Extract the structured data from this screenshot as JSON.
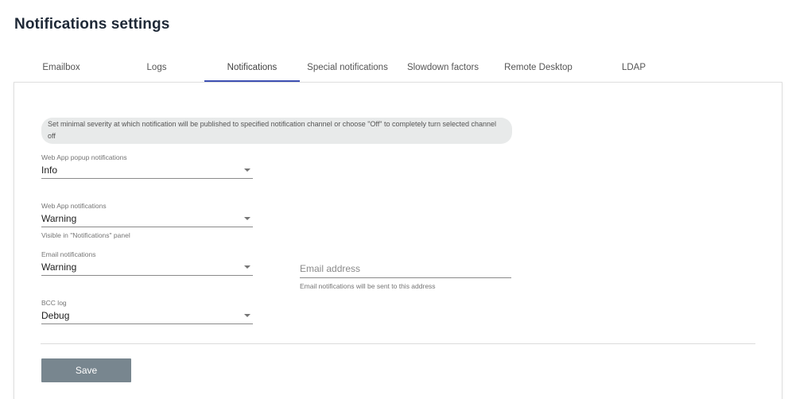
{
  "page_title": "Notifications settings",
  "tabs": [
    {
      "label": "Emailbox",
      "active": false
    },
    {
      "label": "Logs",
      "active": false
    },
    {
      "label": "Notifications",
      "active": true
    },
    {
      "label": "Special notifications",
      "active": false
    },
    {
      "label": "Slowdown factors",
      "active": false
    },
    {
      "label": "Remote Desktop",
      "active": false
    },
    {
      "label": "LDAP",
      "active": false
    }
  ],
  "info_text": "Set minimal severity at which notification will be published to specified notification channel or choose \"Off\" to completely turn selected channel off",
  "fields": {
    "web_app_popup": {
      "label": "Web App popup notifications",
      "value": "Info"
    },
    "web_app": {
      "label": "Web App notifications",
      "value": "Warning",
      "hint": "Visible in \"Notifications\" panel"
    },
    "email": {
      "label": "Email notifications",
      "value": "Warning"
    },
    "bcc_log": {
      "label": "BCC log",
      "value": "Debug"
    }
  },
  "email_address": {
    "placeholder": "Email address",
    "value": "",
    "hint": "Email notifications will be sent to this address"
  },
  "save_label": "Save",
  "colors": {
    "active_tab_indicator": "#3f51b5",
    "save_button_bg": "#78868f",
    "info_box_bg": "#e8eaea"
  }
}
